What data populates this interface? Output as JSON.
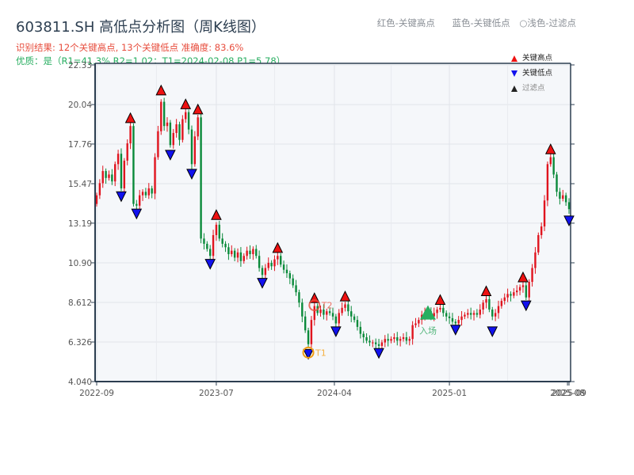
{
  "header": {
    "title": "603811.SH 高低点分析图（周K线图）",
    "result": "识别结果: 12个关键高点, 13个关键低点  准确度: 83.6%",
    "quality": "优质：是（R1=41.3%  R2=1.02；T1=2024-02-08 P1=5.78）",
    "color_legend": [
      "红色-关键高点",
      "蓝色-关键低点",
      "○浅色-过滤点"
    ]
  },
  "legend": {
    "items": [
      {
        "label": "关键高点",
        "color": "#ee1111"
      },
      {
        "label": "关键低点",
        "color": "#1111ee"
      },
      {
        "label": "过滤点",
        "color": "#ffffff"
      }
    ]
  },
  "colors": {
    "up": "#e0141e",
    "down": "#0a8a3a",
    "high": "#ee1111",
    "low": "#1111ee",
    "entry": "#27ae60",
    "t1": "#f39c12",
    "t2": "#e74c3c"
  },
  "chart_data": {
    "type": "candlestick",
    "title": "603811.SH 高低点分析图（周K线图）",
    "ylim": [
      4.04,
      22.33
    ],
    "yticks": [
      "22.33",
      "20.04",
      "17.76",
      "15.47",
      "13.19",
      "10.90",
      "8.612",
      "6.326",
      "4.040"
    ],
    "xticks": [
      {
        "label": "2022-09",
        "index": 0
      },
      {
        "label": "2023-07",
        "index": 39
      },
      {
        "label": "2024-04",
        "index": 77.5
      },
      {
        "label": "2025-01",
        "index": 115
      },
      {
        "label": "2025-08",
        "index": 153.5
      },
      {
        "label": "2025-09",
        "index": 154
      }
    ],
    "open_first": 14.3,
    "closes": [
      14.8,
      15.5,
      16.2,
      15.8,
      16.0,
      15.6,
      16.6,
      17.2,
      15.2,
      16.8,
      17.8,
      18.8,
      14.3,
      14.2,
      14.8,
      15.0,
      14.8,
      15.2,
      14.9,
      17.0,
      18.5,
      20.2,
      18.8,
      19.0,
      17.7,
      18.4,
      18.9,
      18.0,
      19.2,
      19.6,
      18.6,
      16.6,
      18.2,
      19.3,
      12.3,
      12.0,
      11.7,
      11.3,
      12.5,
      13.1,
      12.3,
      12.0,
      11.8,
      11.4,
      11.6,
      11.2,
      11.5,
      11.0,
      11.3,
      11.6,
      11.4,
      11.7,
      11.3,
      10.6,
      10.2,
      10.6,
      10.9,
      10.7,
      11.1,
      11.3,
      10.8,
      10.5,
      10.3,
      10.0,
      9.6,
      9.2,
      8.6,
      7.8,
      7.0,
      6.2,
      7.6,
      8.4,
      8.0,
      8.2,
      7.9,
      8.1,
      8.0,
      7.8,
      7.4,
      8.0,
      8.3,
      8.5,
      8.1,
      7.8,
      7.6,
      7.2,
      6.8,
      6.6,
      6.4,
      6.3,
      6.3,
      6.2,
      6.1,
      6.3,
      6.5,
      6.4,
      6.5,
      6.6,
      6.4,
      6.5,
      6.6,
      6.4,
      6.5,
      7.3,
      7.4,
      7.6,
      7.9,
      8.0,
      8.1,
      7.8,
      8.0,
      8.2,
      8.3,
      8.0,
      7.8,
      7.7,
      7.5,
      7.4,
      7.6,
      7.8,
      7.9,
      8.0,
      7.9,
      8.0,
      7.9,
      8.2,
      8.6,
      8.8,
      8.2,
      7.8,
      8.0,
      8.4,
      8.7,
      8.9,
      9.1,
      9.0,
      9.2,
      9.3,
      9.5,
      9.6,
      8.9,
      9.8,
      10.6,
      11.5,
      12.5,
      13.0,
      14.5,
      16.6,
      17.0,
      16.0,
      15.0,
      14.6,
      14.8,
      14.4,
      14.0
    ],
    "key_highs": [
      {
        "i": 11,
        "p": 19.0
      },
      {
        "i": 21,
        "p": 20.6
      },
      {
        "i": 29,
        "p": 19.8
      },
      {
        "i": 33,
        "p": 19.5
      },
      {
        "i": 39,
        "p": 13.4
      },
      {
        "i": 59,
        "p": 11.5
      },
      {
        "i": 71,
        "p": 8.6
      },
      {
        "i": 81,
        "p": 8.7
      },
      {
        "i": 112,
        "p": 8.5
      },
      {
        "i": 127,
        "p": 9.0
      },
      {
        "i": 139,
        "p": 9.8
      },
      {
        "i": 148,
        "p": 17.2
      }
    ],
    "key_lows": [
      {
        "i": 8,
        "p": 15.0
      },
      {
        "i": 13,
        "p": 14.0
      },
      {
        "i": 24,
        "p": 17.4
      },
      {
        "i": 31,
        "p": 16.3
      },
      {
        "i": 37,
        "p": 11.1
      },
      {
        "i": 54,
        "p": 10.0
      },
      {
        "i": 69,
        "p": 5.9
      },
      {
        "i": 78,
        "p": 7.2
      },
      {
        "i": 92,
        "p": 5.95
      },
      {
        "i": 117,
        "p": 7.3
      },
      {
        "i": 129,
        "p": 7.2
      },
      {
        "i": 140,
        "p": 8.7
      },
      {
        "i": 154,
        "p": 13.6
      }
    ],
    "entry": {
      "i": 108,
      "p": 7.9,
      "label": "入场"
    },
    "t1": {
      "i": 69,
      "p": 5.9,
      "label": "T1"
    },
    "t2": {
      "i": 71,
      "p": 8.45,
      "label": "T2"
    }
  }
}
